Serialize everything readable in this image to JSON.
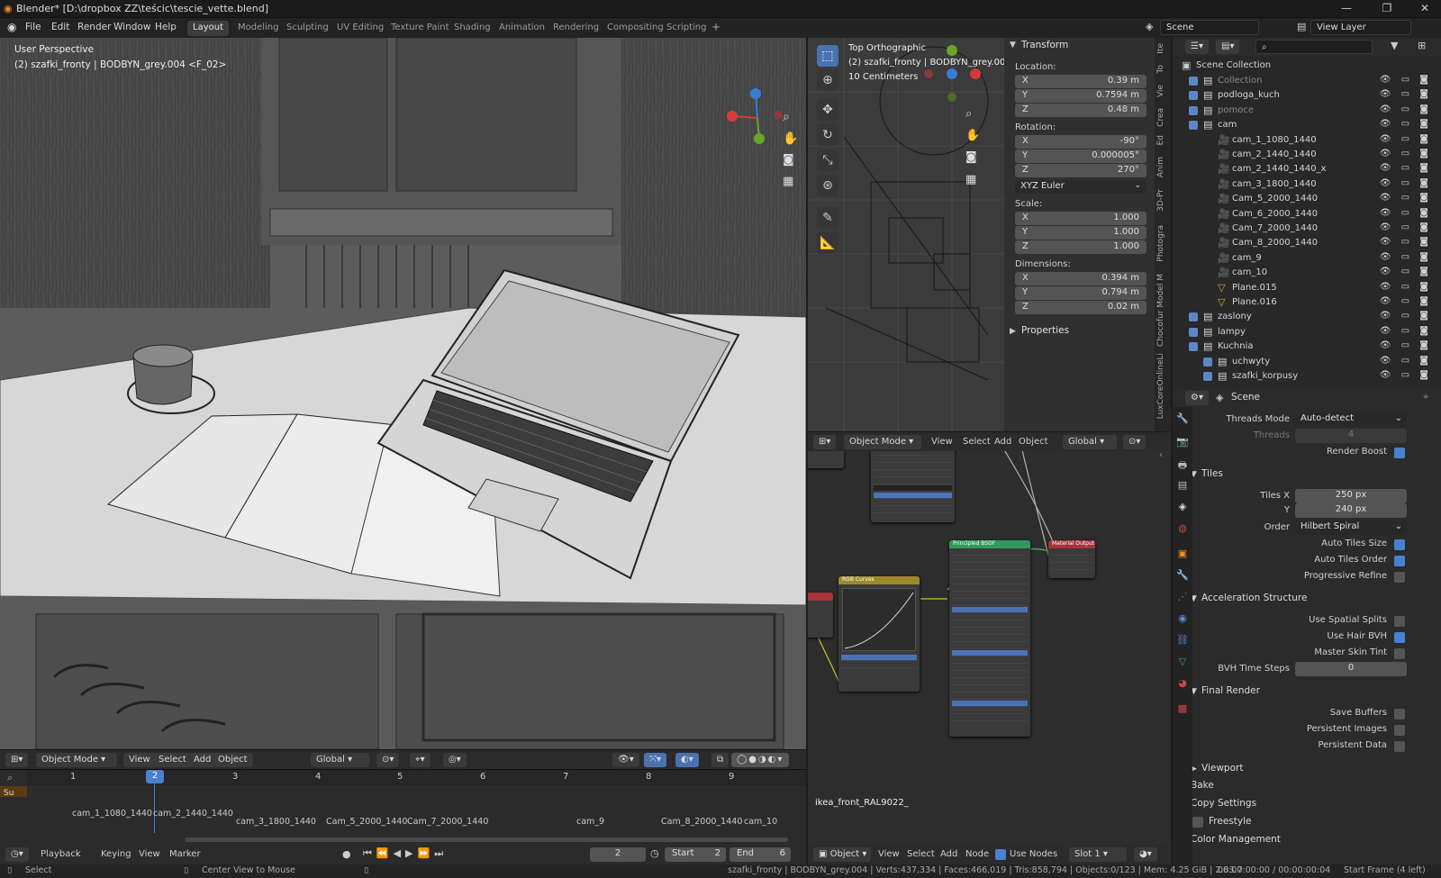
{
  "app": {
    "window_title": "Blender* [D:\\dropbox ZZ\\teścic\\tescie_vette.blend]",
    "menus": [
      "File",
      "Edit",
      "Render",
      "Window",
      "Help"
    ],
    "workspaces": [
      "Layout",
      "Modeling",
      "Sculpting",
      "UV Editing",
      "Texture Paint",
      "Shading",
      "Animation",
      "Rendering",
      "Compositing",
      "Scripting"
    ],
    "active_workspace": "Layout",
    "scene_name": "Scene",
    "view_layer": "View Layer"
  },
  "viewport": {
    "perspective_label": "User Perspective",
    "object_label": "(2) szafki_fronty | BODBYN_grey.004 <F_02>",
    "mode": "Object Mode",
    "menu": [
      "View",
      "Select",
      "Add",
      "Object"
    ],
    "orientation": "Global"
  },
  "top_view": {
    "title": "Top Orthographic",
    "object_label": "(2) szafki_fronty | BODBYN_grey.004 <",
    "scale_label": "10 Centimeters",
    "mode": "Object Mode",
    "menu": [
      "View",
      "Select",
      "Add",
      "Object"
    ],
    "orientation": "Global"
  },
  "transform": {
    "header": "Transform",
    "location_label": "Location:",
    "location": [
      {
        "axis": "X",
        "value": "0.39 m"
      },
      {
        "axis": "Y",
        "value": "0.7594 m"
      },
      {
        "axis": "Z",
        "value": "0.48 m"
      }
    ],
    "rotation_label": "Rotation:",
    "rotation": [
      {
        "axis": "X",
        "value": "-90°"
      },
      {
        "axis": "Y",
        "value": "0.000005°"
      },
      {
        "axis": "Z",
        "value": "270°"
      }
    ],
    "rotation_mode": "XYZ Euler",
    "scale_label": "Scale:",
    "scale": [
      {
        "axis": "X",
        "value": "1.000"
      },
      {
        "axis": "Y",
        "value": "1.000"
      },
      {
        "axis": "Z",
        "value": "1.000"
      }
    ],
    "dimensions_label": "Dimensions:",
    "dimensions": [
      {
        "axis": "X",
        "value": "0.394 m"
      },
      {
        "axis": "Y",
        "value": "0.794 m"
      },
      {
        "axis": "Z",
        "value": "0.02 m"
      }
    ],
    "properties_header": "Properties"
  },
  "sidetabs": [
    "Ite",
    "To",
    "Vie",
    "Crea",
    "Ed",
    "Anim",
    "3D-Pr",
    "Photogra",
    "Chocofur Model M",
    "LuxCoreOnlineLi"
  ],
  "outliner": {
    "root": "Scene Collection",
    "rows": [
      {
        "name": "Collection",
        "depth": 1,
        "icon": "collection"
      },
      {
        "name": "podloga_kuch",
        "depth": 1,
        "icon": "collection"
      },
      {
        "name": "pomoce",
        "depth": 1,
        "icon": "collection"
      },
      {
        "name": "cam",
        "depth": 1,
        "icon": "collection"
      },
      {
        "name": "cam_1_1080_1440",
        "depth": 2,
        "icon": "camera"
      },
      {
        "name": "cam_2_1440_1440",
        "depth": 2,
        "icon": "camera"
      },
      {
        "name": "cam_2_1440_1440_x",
        "depth": 2,
        "icon": "camera"
      },
      {
        "name": "cam_3_1800_1440",
        "depth": 2,
        "icon": "camera"
      },
      {
        "name": "Cam_5_2000_1440",
        "depth": 2,
        "icon": "camera"
      },
      {
        "name": "Cam_6_2000_1440",
        "depth": 2,
        "icon": "camera"
      },
      {
        "name": "Cam_7_2000_1440",
        "depth": 2,
        "icon": "camera"
      },
      {
        "name": "Cam_8_2000_1440",
        "depth": 2,
        "icon": "camera"
      },
      {
        "name": "cam_9",
        "depth": 2,
        "icon": "camera"
      },
      {
        "name": "cam_10",
        "depth": 2,
        "icon": "camera"
      },
      {
        "name": "Plane.015",
        "depth": 2,
        "icon": "mesh"
      },
      {
        "name": "Plane.016",
        "depth": 2,
        "icon": "mesh"
      },
      {
        "name": "zaslony",
        "depth": 1,
        "icon": "collection"
      },
      {
        "name": "lampy",
        "depth": 1,
        "icon": "collection"
      },
      {
        "name": "Kuchnia",
        "depth": 1,
        "icon": "collection"
      },
      {
        "name": "uchwyty",
        "depth": 2,
        "icon": "collection"
      },
      {
        "name": "szafki_korpusy",
        "depth": 2,
        "icon": "collection"
      }
    ]
  },
  "properties": {
    "context": "Scene",
    "threads_mode_label": "Threads Mode",
    "threads_mode": "Auto-detect",
    "threads_label": "Threads",
    "threads": "4",
    "render_boost": "Render Boost",
    "tiles_section": "Tiles",
    "tiles_x_label": "Tiles X",
    "tiles_x": "250 px",
    "tiles_y_label": "Y",
    "tiles_y": "240 px",
    "order_label": "Order",
    "order": "Hilbert Spiral",
    "auto_tiles_size": "Auto Tiles Size",
    "auto_tiles_order": "Auto Tiles Order",
    "progressive_refine": "Progressive Refine",
    "accel_section": "Acceleration Structure",
    "use_spatial_splits": "Use Spatial Splits",
    "use_hair_bvh": "Use Hair BVH",
    "master_skin_tint": "Master Skin Tint",
    "bvh_time_steps_label": "BVH Time Steps",
    "bvh_time_steps": "0",
    "final_render_section": "Final Render",
    "save_buffers": "Save Buffers",
    "persistent_images": "Persistent Images",
    "persistent_data": "Persistent Data",
    "collapsed_sections": [
      "Viewport",
      "Bake",
      "Copy Settings",
      "Freestyle",
      "Color Management"
    ]
  },
  "node_editor": {
    "material_label": "ikea_front_RAL9022_",
    "nodes": [
      {
        "title": "RGB Curves",
        "color": "#9c8a2a"
      },
      {
        "title": "Principled BSDF",
        "color": "#2f9a5d"
      },
      {
        "title": "Material Output",
        "color": "#a8333a"
      }
    ],
    "header": {
      "object": "Object",
      "menu": [
        "View",
        "Select",
        "Add",
        "Node"
      ],
      "use_nodes": "Use Nodes",
      "slot": "Slot 1"
    }
  },
  "timeline": {
    "frame_numbers": [
      "1",
      "2",
      "3",
      "4",
      "5",
      "6",
      "7",
      "8",
      "9"
    ],
    "current_frame_marker": "2",
    "markers": [
      "cam_1_1080_1440",
      "cam_2_1440_1440",
      "cam_3_1800_1440",
      "Cam_5_2000_1440",
      "Cam_7_2000_1440",
      "cam_9",
      "Cam_8_2000_1440",
      "cam_10"
    ],
    "summary_label": "Su",
    "menu": [
      "Playback",
      "Keying",
      "View",
      "Marker"
    ],
    "current_frame": "2",
    "start_label": "Start",
    "start": "2",
    "end_label": "End",
    "end": "6"
  },
  "statusbar": {
    "left_action": "Select",
    "middle_action": "Center View to Mouse",
    "stats": "szafki_fronty | BODBYN_grey.004 | Verts:437,334 | Faces:466,019 | Tris:858,794 | Objects:0/123 | Mem: 4.25 GiB | 2.83.7",
    "time": "00:00:00:00 / 00:00:00:04",
    "frame_info": "Start Frame (4 left)"
  },
  "colors": {
    "accent": "#4a80d0",
    "header_bg": "#2b2b2b",
    "panel_bg": "#303030"
  }
}
